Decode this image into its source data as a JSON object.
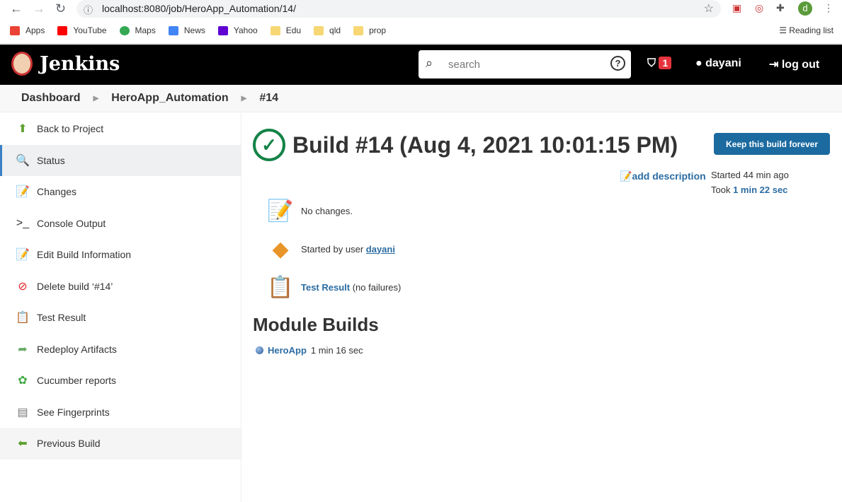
{
  "browser": {
    "url": "localhost:8080/job/HeroApp_Automation/14/",
    "avatar_letter": "d",
    "bookmarks": [
      {
        "label": "Apps",
        "color": "#ea4335"
      },
      {
        "label": "YouTube",
        "color": "#ff0000"
      },
      {
        "label": "Maps",
        "color": "#34a853"
      },
      {
        "label": "News",
        "color": "#4285f4"
      },
      {
        "label": "Yahoo",
        "color": "#6001d2"
      },
      {
        "label": "Edu",
        "color": "#f7d774"
      },
      {
        "label": "qld",
        "color": "#f7d774"
      },
      {
        "label": "prop",
        "color": "#f7d774"
      }
    ],
    "reading_list": "Reading list"
  },
  "header": {
    "brand": "Jenkins",
    "search_placeholder": "search",
    "alerts": "1",
    "user": "dayani",
    "logout": "log out"
  },
  "breadcrumbs": [
    "Dashboard",
    "HeroApp_Automation",
    "#14"
  ],
  "sidebar": {
    "items": [
      {
        "label": "Back to Project",
        "icon": "⬆",
        "color": "#5aa02c"
      },
      {
        "label": "Status",
        "icon": "🔍",
        "color": "#3b81c3"
      },
      {
        "label": "Changes",
        "icon": "📝",
        "color": "#888"
      },
      {
        "label": "Console Output",
        "icon": ">_",
        "color": "#333"
      },
      {
        "label": "Edit Build Information",
        "icon": "📝",
        "color": "#888"
      },
      {
        "label": "Delete build ‘#14’",
        "icon": "⊘",
        "color": "#d22"
      },
      {
        "label": "Test Result",
        "icon": "📋",
        "color": "#a87"
      },
      {
        "label": "Redeploy Artifacts",
        "icon": "➦",
        "color": "#6a6"
      },
      {
        "label": "Cucumber reports",
        "icon": "✿",
        "color": "#4a4"
      },
      {
        "label": "See Fingerprints",
        "icon": "▤",
        "color": "#777"
      },
      {
        "label": "Previous Build",
        "icon": "⬅",
        "color": "#5aa02c"
      }
    ]
  },
  "main": {
    "title": "Build #14 (Aug 4, 2021 10:01:15 PM)",
    "keep_button": "Keep this build forever",
    "add_description": "add description",
    "started": "Started 44 min ago",
    "took_prefix": "Took ",
    "took": "1 min 22 sec",
    "changes": "No changes.",
    "started_by": "Started by user ",
    "started_by_user": "dayani",
    "test_result": "Test Result",
    "test_result_suffix": " (no failures)",
    "module_heading": "Module Builds",
    "module": {
      "name": "HeroApp",
      "duration": "1 min 16 sec"
    }
  }
}
